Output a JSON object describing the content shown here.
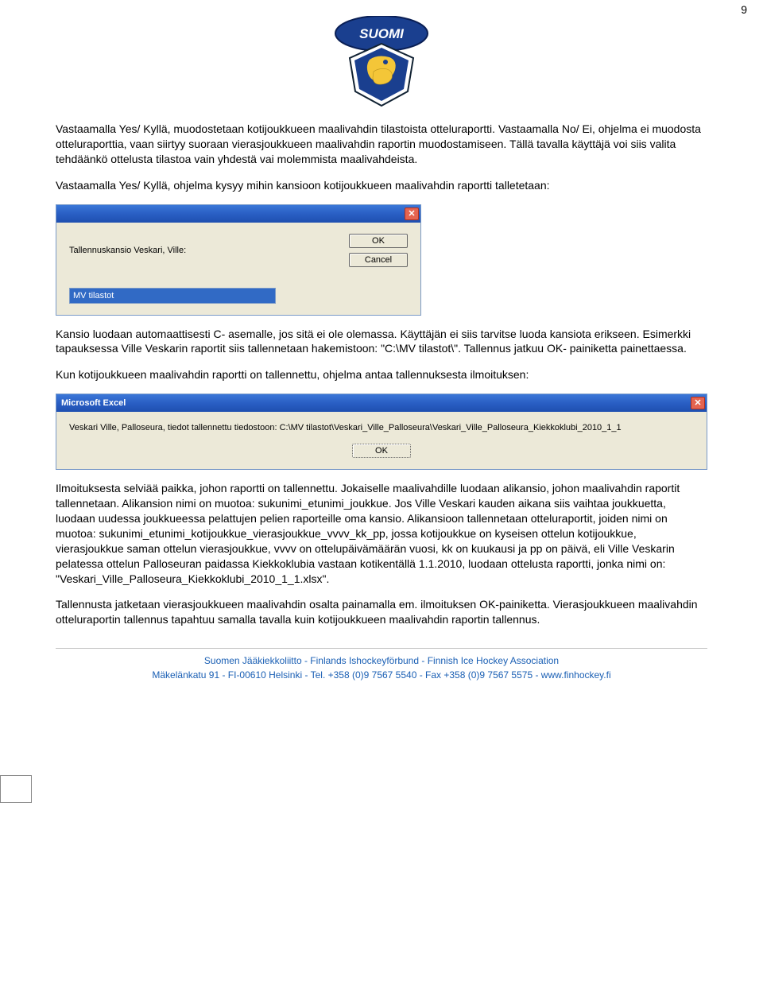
{
  "page_number": "9",
  "logo_text": "SUOMI",
  "paragraphs": {
    "p1": "Vastaamalla Yes/ Kyllä, muodostetaan kotijoukkueen maalivahdin tilastoista otteluraportti. Vastaamalla No/ Ei, ohjelma ei muodosta otteluraporttia, vaan siirtyy suoraan vierasjoukkueen maalivahdin raportin muodostamiseen. Tällä tavalla käyttäjä voi siis valita tehdäänkö ottelusta tilastoa vain yhdestä vai molemmista maalivahdeista.",
    "p2": "Vastaamalla Yes/ Kyllä, ohjelma kysyy mihin kansioon kotijoukkueen maalivahdin raportti talletetaan:",
    "p3": "Kansio luodaan automaattisesti C- asemalle, jos sitä ei ole olemassa. Käyttäjän ei siis tarvitse luoda kansiota erikseen. Esimerkki tapauksessa Ville Veskarin raportit siis tallennetaan hakemistoon: \"C:\\MV tilastot\\\". Tallennus jatkuu OK- painiketta painettaessa.",
    "p4": "Kun kotijoukkueen maalivahdin raportti on tallennettu, ohjelma antaa tallennuksesta ilmoituksen:",
    "p5": "Ilmoituksesta selviää paikka, johon raportti on tallennettu. Jokaiselle maalivahdille luodaan alikansio, johon maalivahdin raportit tallennetaan. Alikansion nimi on muotoa: sukunimi_etunimi_joukkue. Jos Ville Veskari kauden aikana siis vaihtaa joukkuetta, luodaan uudessa joukkueessa pelattujen pelien raporteille oma kansio. Alikansioon tallennetaan otteluraportit, joiden nimi on muotoa: sukunimi_etunimi_kotijoukkue_vierasjoukkue_vvvv_kk_pp, jossa kotijoukkue on kyseisen ottelun kotijoukkue, vierasjoukkue saman ottelun vierasjoukkue, vvvv on ottelupäivämäärän vuosi, kk on kuukausi ja pp on päivä, eli Ville Veskarin pelatessa ottelun Palloseuran paidassa Kiekkoklubia vastaan kotikentällä 1.1.2010, luodaan ottelusta raportti, jonka nimi on: \"Veskari_Ville_Palloseura_Kiekkoklubi_2010_1_1.xlsx\".",
    "p6": "Tallennusta jatketaan vierasjoukkueen maalivahdin osalta painamalla em. ilmoituksen OK-painiketta. Vierasjoukkueen maalivahdin otteluraportin tallennus tapahtuu samalla tavalla kuin kotijoukkueen maalivahdin raportin tallennus."
  },
  "dialog1": {
    "title": "",
    "label": "Tallennuskansio Veskari, Ville:",
    "ok": "OK",
    "cancel": "Cancel",
    "input_value": "MV tilastot"
  },
  "dialog2": {
    "title": "Microsoft Excel",
    "message": "Veskari Ville, Palloseura, tiedot tallennettu tiedostoon: C:\\MV tilastot\\Veskari_Ville_Palloseura\\Veskari_Ville_Palloseura_Kiekkoklubi_2010_1_1",
    "ok": "OK"
  },
  "footer": {
    "line1": "Suomen Jääkiekkoliitto - Finlands Ishockeyförbund - Finnish Ice Hockey Association",
    "line2": "Mäkelänkatu 91 - FI-00610 Helsinki - Tel. +358 (0)9 7567 5540 - Fax +358 (0)9 7567 5575 - www.finhockey.fi"
  }
}
